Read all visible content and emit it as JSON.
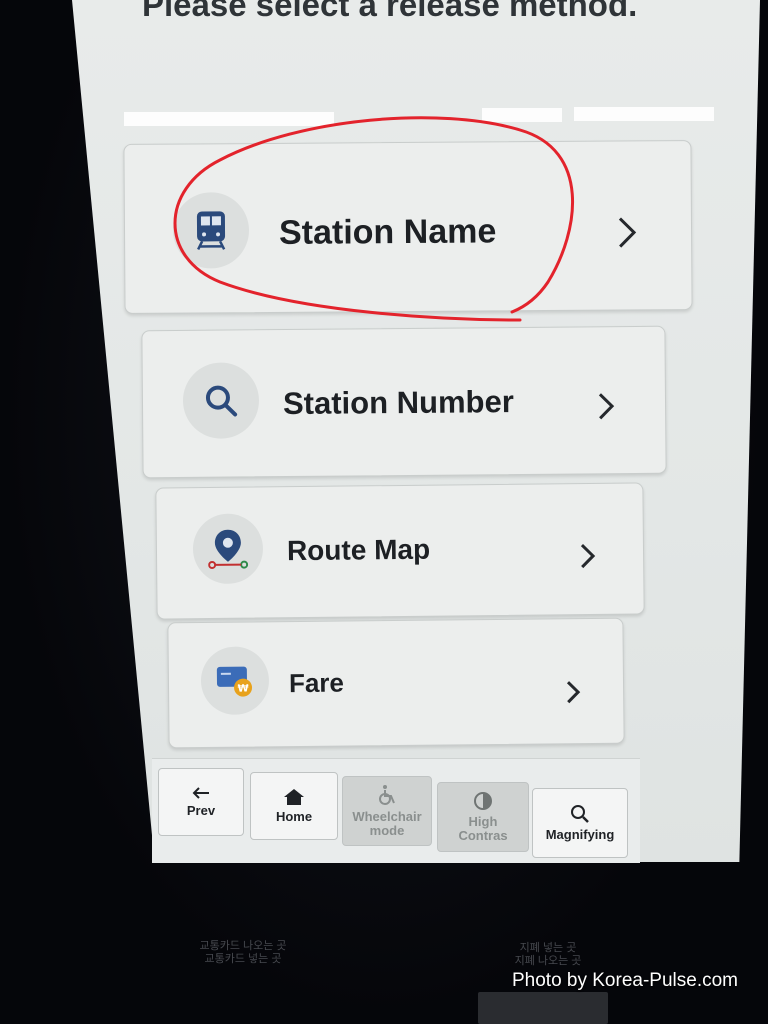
{
  "header": {
    "title": "Please select a release method."
  },
  "options": [
    {
      "label": "Station Name",
      "icon": "train-icon"
    },
    {
      "label": "Station Number",
      "icon": "search-icon"
    },
    {
      "label": "Route Map",
      "icon": "map-pin-icon"
    },
    {
      "label": "Fare",
      "icon": "fare-card-icon"
    }
  ],
  "toolbar": {
    "prev": "Prev",
    "home": "Home",
    "wheelchair_line1": "Wheelchair",
    "wheelchair_line2": "mode",
    "contrast_line1": "High",
    "contrast_line2": "Contras",
    "magnify": "Magnifying"
  },
  "kiosk_labels": {
    "left_line1": "교통카드 나오는 곳",
    "left_line2": "교통카드 넣는 곳",
    "right_line1": "지폐 넣는 곳",
    "right_line2": "지폐 나오는 곳"
  },
  "watermark": "Photo by Korea-Pulse.com",
  "colors": {
    "accent_circle": "#e3232c",
    "icon_blue": "#2b4a7c",
    "coin": "#e8a21c"
  }
}
